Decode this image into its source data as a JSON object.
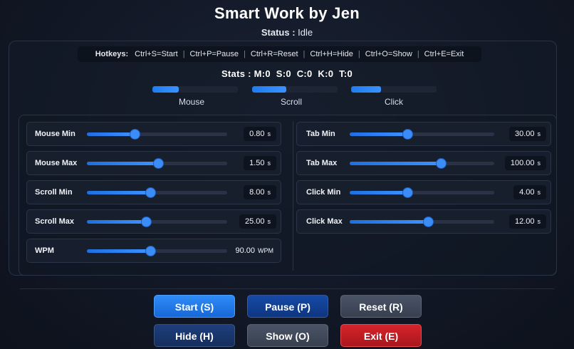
{
  "app": {
    "title": "Smart Work by Jen"
  },
  "status": {
    "label": "Status :",
    "value": "Idle"
  },
  "hotkeys": {
    "label": "Hotkeys:",
    "items": [
      "Ctrl+S=Start",
      "Ctrl+P=Pause",
      "Ctrl+R=Reset",
      "Ctrl+H=Hide",
      "Ctrl+O=Show",
      "Ctrl+E=Exit"
    ]
  },
  "stats": {
    "text": "Stats : M:0  S:0  C:0  K:0  T:0",
    "bars": [
      {
        "label": "Mouse",
        "progress": 0.31
      },
      {
        "label": "Scroll",
        "progress": 0.4
      },
      {
        "label": "Click",
        "progress": 0.35
      }
    ]
  },
  "settings": {
    "left": [
      {
        "label": "Mouse Min",
        "value": "0.80",
        "unit": "s",
        "slider": 0.34
      },
      {
        "label": "Mouse Max",
        "value": "1.50",
        "unit": "s",
        "slider": 0.51
      },
      {
        "label": "Scroll Min",
        "value": "8.00",
        "unit": "s",
        "slider": 0.45
      },
      {
        "label": "Scroll Max",
        "value": "25.00",
        "unit": "s",
        "slider": 0.42
      },
      {
        "label": "WPM",
        "value": "90.00",
        "unit": "WPM",
        "slider": 0.45
      }
    ],
    "right": [
      {
        "label": "Tab Min",
        "value": "30.00",
        "unit": "s",
        "slider": 0.4
      },
      {
        "label": "Tab Max",
        "value": "100.00",
        "unit": "s",
        "slider": 0.63
      },
      {
        "label": "Click Min",
        "value": "4.00",
        "unit": "s",
        "slider": 0.4
      },
      {
        "label": "Click Max",
        "value": "12.00",
        "unit": "s",
        "slider": 0.54
      }
    ]
  },
  "buttons": {
    "start": "Start (S)",
    "pause": "Pause (P)",
    "reset": "Reset (R)",
    "hide": "Hide (H)",
    "show": "Show (O)",
    "exit": "Exit (E)"
  },
  "colors": {
    "accent": "#1f7df0",
    "exit": "#d5242b",
    "background": "#121826"
  }
}
